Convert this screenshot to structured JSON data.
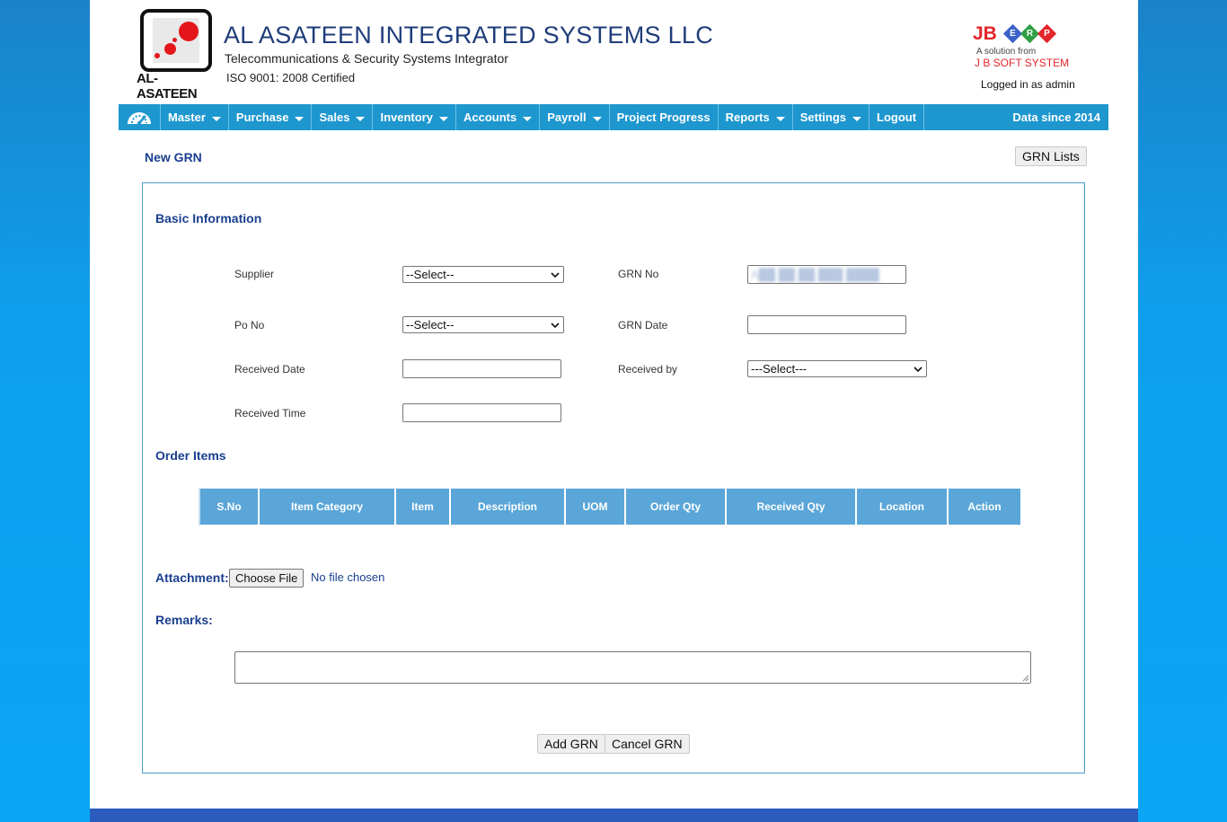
{
  "header": {
    "logo_text": "AL-ASATEEN",
    "company_name": "AL ASATEEN INTEGRATED SYSTEMS LLC",
    "tagline": "Telecommunications & Security Systems Integrator",
    "certification": "ISO 9001: 2008 Certified",
    "erp_brand": {
      "jb": "JB",
      "letters": [
        "E",
        "R",
        "P"
      ],
      "line1": "A solution from",
      "line2": "J B SOFT SYSTEM"
    },
    "logged_in": "Logged in as admin"
  },
  "nav": {
    "items": [
      {
        "label": "Master",
        "dropdown": true
      },
      {
        "label": "Purchase",
        "dropdown": true
      },
      {
        "label": "Sales",
        "dropdown": true
      },
      {
        "label": "Inventory",
        "dropdown": true
      },
      {
        "label": "Accounts",
        "dropdown": true
      },
      {
        "label": "Payroll",
        "dropdown": true
      },
      {
        "label": "Project Progress",
        "dropdown": false
      },
      {
        "label": "Reports",
        "dropdown": true
      },
      {
        "label": "Settings",
        "dropdown": true
      },
      {
        "label": "Logout",
        "dropdown": false
      }
    ],
    "data_since": "Data since 2014"
  },
  "page": {
    "title": "New GRN",
    "grn_lists_button": "GRN Lists"
  },
  "basic_info": {
    "title": "Basic Information",
    "supplier_label": "Supplier",
    "supplier_value": "--Select--",
    "po_no_label": "Po No",
    "po_no_value": "--Select--",
    "grn_no_label": "GRN No",
    "grn_no_value": "A██ ██ ██ ███ ████",
    "grn_date_label": "GRN Date",
    "grn_date_value": "",
    "received_date_label": "Received Date",
    "received_date_value": "",
    "received_by_label": "Received by",
    "received_by_value": "---Select---",
    "received_time_label": "Received Time",
    "received_time_value": ""
  },
  "order_items": {
    "title": "Order Items",
    "columns": [
      "S.No",
      "Item Category",
      "Item",
      "Description",
      "UOM",
      "Order Qty",
      "Received Qty",
      "Location",
      "Action"
    ]
  },
  "attachment": {
    "label": "Attachment:",
    "choose_button": "Choose File",
    "status": "No file chosen"
  },
  "remarks": {
    "label": "Remarks:",
    "value": ""
  },
  "actions": {
    "add": "Add GRN",
    "cancel": "Cancel GRN"
  },
  "colors": {
    "nav_bg": "#1e97cf",
    "table_header": "#5aa6d8",
    "heading": "#1a3f8f",
    "brand_red": "#e2262b"
  }
}
